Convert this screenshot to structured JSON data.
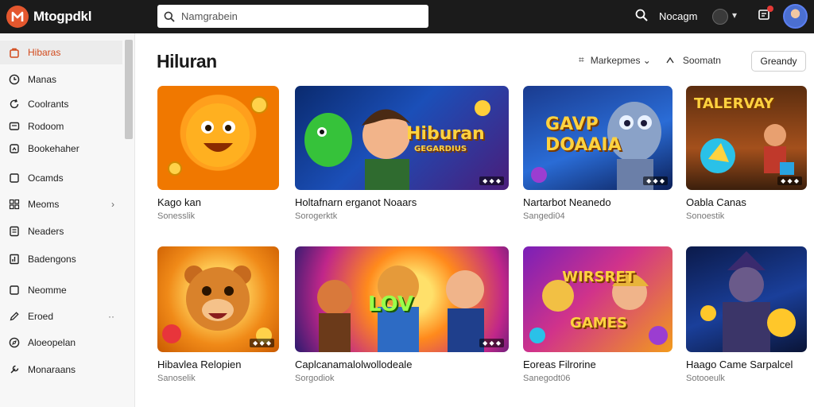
{
  "app": {
    "name": "Mtogpdkl"
  },
  "search": {
    "placeholder": "Namgrabein"
  },
  "topbar": {
    "label": "Nocagm",
    "menu_glyph": "▾"
  },
  "sidebar": {
    "items": [
      {
        "label": "Hibaras",
        "icon": "bag-icon"
      },
      {
        "label": "Manas",
        "icon": "clock-icon"
      },
      {
        "label": "Coolrants",
        "icon": "refresh-icon"
      },
      {
        "label": "Rodoom",
        "icon": "tv-icon"
      },
      {
        "label": "Bookehaher",
        "icon": "bookmark-icon"
      },
      {
        "label": "Ocamds",
        "icon": "square-icon"
      },
      {
        "label": "Meoms",
        "icon": "grid-icon",
        "trail": "›"
      },
      {
        "label": "Neaders",
        "icon": "list-icon"
      },
      {
        "label": "Badengons",
        "icon": "chart-icon"
      },
      {
        "label": "Neomme",
        "icon": "box-icon"
      },
      {
        "label": "Eroed",
        "icon": "pen-icon",
        "trail": "··"
      },
      {
        "label": "Aloeopelan",
        "icon": "compass-icon"
      },
      {
        "label": "Monaraans",
        "icon": "tool-icon"
      }
    ]
  },
  "main": {
    "title": "Hiluran",
    "filter_hash": "⌗",
    "filter_label": "Markepmes",
    "filter_chevron": "⌄",
    "sort_label": "Soomatn",
    "button_label": "Greandy",
    "cards": [
      {
        "title": "Kago kan",
        "subtitle": "Sonesslik",
        "theme": "sun"
      },
      {
        "title": "Holtafnarn erganot Noaars",
        "subtitle": "Sorogerktk",
        "theme": "hero",
        "art_text": "Hiburan",
        "art_sub": "GEGARDIUS",
        "tag": "◆ ◆ ◆"
      },
      {
        "title": "Nartarbot Neanedo",
        "subtitle": "Sangedi04",
        "theme": "robot",
        "art_text": "GAVP DOAAIA",
        "tag": "◆ ◆ ◆"
      },
      {
        "title": "Oabla Canas",
        "subtitle": "Sonoestik",
        "theme": "arcade",
        "art_text": "TALERVAY",
        "tag": "◆ ◆ ◆"
      },
      {
        "title": "Hibavlea Relopien",
        "subtitle": "Sanoselik",
        "theme": "bear",
        "tag": "◆ ◆ ◆"
      },
      {
        "title": "Caplcanamalolwollodeale",
        "subtitle": "Sorgodiok",
        "theme": "crew",
        "art_text": "LOV",
        "tag": "◆ ◆ ◆"
      },
      {
        "title": "Eoreas Filrorine",
        "subtitle": "Sanegodt06",
        "theme": "games",
        "art_text": "WIRSRET GAMES"
      },
      {
        "title": "Haago Came Sarpalcel",
        "subtitle": "Sotooeulk",
        "theme": "knight"
      }
    ]
  }
}
